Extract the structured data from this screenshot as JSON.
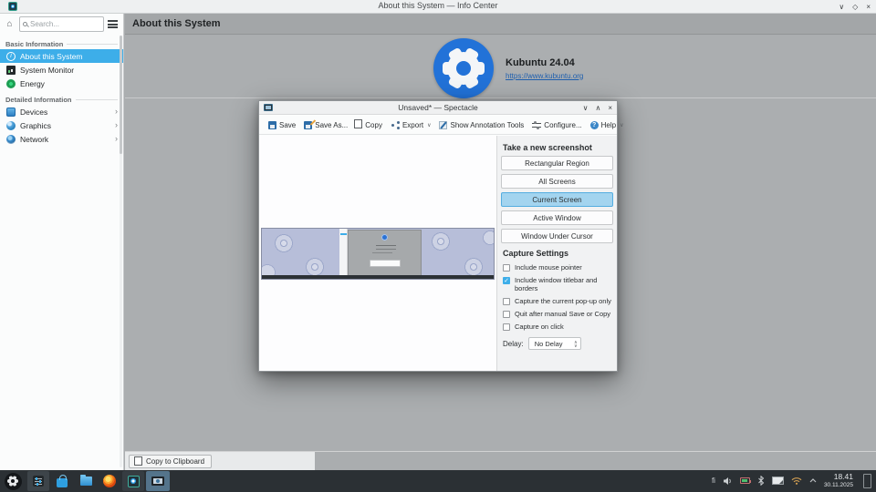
{
  "icons": {
    "min": "∨",
    "max_diamond": "◇",
    "max_up": "∧",
    "close": "×",
    "home": "⌂",
    "chevron": "›",
    "dropdown": "∨",
    "check": "✓",
    "question": "?",
    "info_i": "i",
    "spin_up": "∧",
    "spin_down": "∨"
  },
  "titlebar": {
    "title": "About this System — Info Center"
  },
  "sidebar": {
    "search_placeholder": "Search...",
    "sections": [
      {
        "label": "Basic Information",
        "items": [
          {
            "label": "About this System",
            "selected": true
          },
          {
            "label": "System Monitor",
            "selected": false
          },
          {
            "label": "Energy",
            "selected": false
          }
        ]
      },
      {
        "label": "Detailed Information",
        "items": [
          {
            "label": "Devices",
            "chevron": true
          },
          {
            "label": "Graphics",
            "chevron": true
          },
          {
            "label": "Network",
            "chevron": true
          }
        ]
      }
    ]
  },
  "main": {
    "header": "About this System",
    "product": "Kubuntu 24.04",
    "website": "https://www.kubuntu.org",
    "copy_to_clipboard": "Copy to Clipboard"
  },
  "spectacle": {
    "title": "Unsaved* — Spectacle",
    "toolbar": {
      "save": "Save",
      "save_as": "Save As...",
      "copy": "Copy",
      "export": "Export",
      "annotate": "Show Annotation Tools",
      "configure": "Configure...",
      "help": "Help"
    },
    "panel": {
      "new_screenshot_heading": "Take a new screenshot",
      "capture_buttons": [
        {
          "label": "Rectangular Region",
          "active": false
        },
        {
          "label": "All Screens",
          "active": false
        },
        {
          "label": "Current Screen",
          "active": true
        },
        {
          "label": "Active Window",
          "active": false
        },
        {
          "label": "Window Under Cursor",
          "active": false
        }
      ],
      "settings_heading": "Capture Settings",
      "options": [
        {
          "label": "Include mouse pointer",
          "checked": false
        },
        {
          "label": "Include window titlebar and borders",
          "checked": true
        },
        {
          "label": "Capture the current pop-up only",
          "checked": false
        },
        {
          "label": "Quit after manual Save or Copy",
          "checked": false
        },
        {
          "label": "Capture on click",
          "checked": false
        }
      ],
      "delay_label": "Delay:",
      "delay_value": "No Delay"
    }
  },
  "taskbar": {
    "keyboard_layout": "fi",
    "clock_time": "18.41",
    "clock_date": "30.11.2025"
  },
  "colors": {
    "accent": "#3daee9",
    "link": "#1f5fae",
    "kubuntu_blue": "#2272d8",
    "taskbar_bg": "#2b3034",
    "main_gray": "#abaeb0"
  }
}
